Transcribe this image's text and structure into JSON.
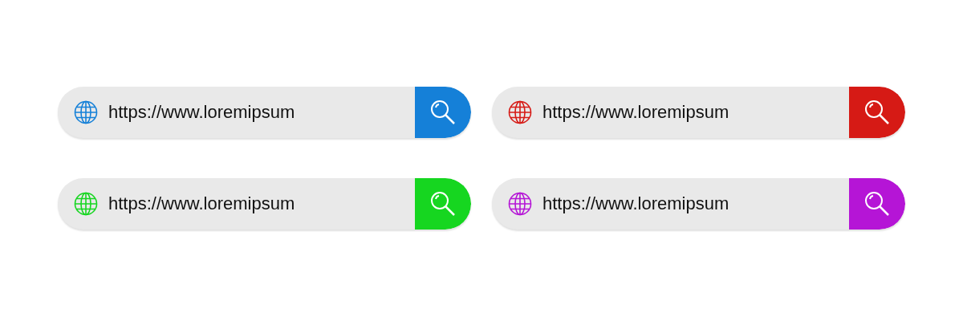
{
  "search_bars": [
    {
      "value": "https://www.loremipsum",
      "color": "#1580d8"
    },
    {
      "value": "https://www.loremipsum",
      "color": "#d61a15"
    },
    {
      "value": "https://www.loremipsum",
      "color": "#16d620"
    },
    {
      "value": "https://www.loremipsum",
      "color": "#b515d6"
    }
  ]
}
